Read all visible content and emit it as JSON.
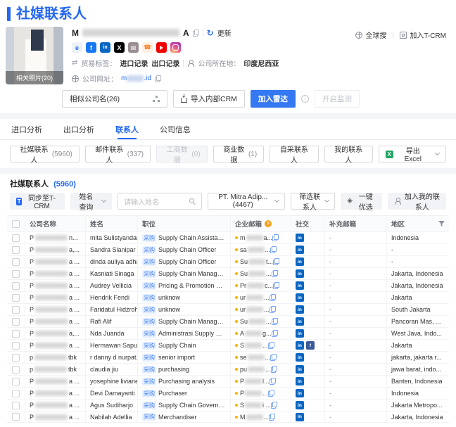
{
  "page": {
    "title": "社媒联系人"
  },
  "colors": {
    "primary": "#2468f2",
    "tag_bg": "#e7f0fe",
    "tag_text": "#4a87f5",
    "email_dot": "#f7b500",
    "linkedin": "#0a66c2",
    "facebook": "#3b5998",
    "excel_green": "#21a463"
  },
  "header": {
    "company_name_prefix": "M",
    "company_name_suffix": "A",
    "update_label": "更新",
    "global_search_label": "全球搜",
    "join_tcrm_label": "加入T-CRM",
    "photo_label": "相关照片(20)",
    "social_icons": [
      "website-icon",
      "facebook-icon",
      "linkedin-icon",
      "x-icon",
      "blog-icon",
      "phone-icon",
      "youtube-icon",
      "instagram-icon"
    ],
    "trade_label": "贸易标签：",
    "import_record": "进口记录",
    "export_record": "出口记录",
    "location_label": "公司所在地：",
    "location_value": "印度尼西亚",
    "website_label": "公司网址：",
    "website_prefix": "m",
    "website_suffix": ".id"
  },
  "actions": {
    "similar_companies_label": "相似公司名(26)",
    "import_crm_label": "导入内部CRM",
    "add_radar_label": "加入雷达",
    "start_monitor_label": "开启监测"
  },
  "tabs": [
    {
      "label": "进口分析",
      "active": false
    },
    {
      "label": "出口分析",
      "active": false
    },
    {
      "label": "联系人",
      "active": true
    },
    {
      "label": "公司信息",
      "active": false
    }
  ],
  "filters": {
    "buttons": [
      {
        "label": "社媒联系人",
        "count": "(5960)",
        "disabled": false
      },
      {
        "label": "邮件联系人",
        "count": "(337)",
        "disabled": false
      },
      {
        "label": "工商数据",
        "count": "(0)",
        "disabled": true
      },
      {
        "label": "商业数据",
        "count": "(1)",
        "disabled": false
      },
      {
        "label": "自采联系人",
        "count": "",
        "disabled": false
      },
      {
        "label": "我的联系人",
        "count": "",
        "disabled": false
      }
    ],
    "export_label": "导出 Excel"
  },
  "section": {
    "title": "社媒联系人",
    "count": "(5960)"
  },
  "toolbar": {
    "sync_label": "同步至T-CRM",
    "name_query_label": "姓名查询",
    "name_placeholder": "请输入姓名",
    "company_filter_value": "PT. Mitra Adip...(4467)",
    "filter_contacts_label": "筛选联系人",
    "quick_select_label": "一键优选",
    "add_my_contacts_label": "加入我的联系人"
  },
  "table": {
    "columns": [
      "公司名称",
      "姓名",
      "职位",
      "企业邮箱",
      "社交",
      "补充邮箱",
      "地区"
    ],
    "tag_label": "采购",
    "rows": [
      {
        "company_prefix": "P",
        "company_suffix": "n...",
        "name": "mita Sulistyandari",
        "position": "Supply Chain Assistant Man...",
        "email_prefix": "m",
        "email_suffix": "a...",
        "socials": [
          "linkedin"
        ],
        "extra_email": "-",
        "region": "Indonesia"
      },
      {
        "company_prefix": "P",
        "company_suffix": "a,...",
        "name": "Sandra Sianipar",
        "position": "Supply Chain Officer",
        "email_prefix": "sa",
        "email_suffix": "...",
        "socials": [
          "linkedin"
        ],
        "extra_email": "-",
        "region": "-"
      },
      {
        "company_prefix": "P",
        "company_suffix": "a ...",
        "name": "dinda auliya adha",
        "position": "Supply Chain Officer",
        "email_prefix": "Su",
        "email_suffix": "t...",
        "socials": [
          "linkedin"
        ],
        "extra_email": "-",
        "region": "-"
      },
      {
        "company_prefix": "P",
        "company_suffix": "a ...",
        "name": "Kasniati Sinaga",
        "position": "Supply Chain Management",
        "email_prefix": "Su",
        "email_suffix": "...",
        "socials": [
          "linkedin"
        ],
        "extra_email": "-",
        "region": "Jakarta, Indonesia"
      },
      {
        "company_prefix": "P",
        "company_suffix": "a ...",
        "name": "Audrey Vellicia",
        "position": "Pricing & Promotion Execut...",
        "email_prefix": "Pr",
        "email_suffix": "c...",
        "socials": [
          "linkedin"
        ],
        "extra_email": "-",
        "region": "Jakarta, Indonesia"
      },
      {
        "company_prefix": "P",
        "company_suffix": "a ...",
        "name": "Hendrik Fendi",
        "position": "unknow",
        "email_prefix": "ur",
        "email_suffix": "...",
        "socials": [
          "linkedin"
        ],
        "extra_email": "-",
        "region": "Jakarta"
      },
      {
        "company_prefix": "P",
        "company_suffix": "a ...",
        "name": "Faridatul Hidzroh",
        "position": "unknow",
        "email_prefix": "ur",
        "email_suffix": "...",
        "socials": [
          "linkedin"
        ],
        "extra_email": "-",
        "region": "South Jakarta"
      },
      {
        "company_prefix": "P",
        "company_suffix": "a ...",
        "name": "Rafi Alif",
        "position": "Supply Chain Management ...",
        "email_prefix": "Su",
        "email_suffix": "...",
        "socials": [
          "linkedin"
        ],
        "extra_email": "-",
        "region": "Pancoran Mas, ..."
      },
      {
        "company_prefix": "P",
        "company_suffix": "a,...",
        "name": "Nda Juanda",
        "position": "Administrasi Supply Chain (...",
        "email_prefix": "A",
        "email_suffix": "g...",
        "socials": [
          "linkedin"
        ],
        "extra_email": "-",
        "region": "West Java, Indo..."
      },
      {
        "company_prefix": "P",
        "company_suffix": "a ...",
        "name": "Hermawan Sapu...",
        "position": "Supply Chain",
        "email_prefix": "S",
        "email_suffix": "...",
        "socials": [
          "linkedin",
          "facebook"
        ],
        "extra_email": "-",
        "region": "Jakarta"
      },
      {
        "company_prefix": "p",
        "company_suffix": "tbk",
        "name": "r danny d nurpat...",
        "position": "senior import",
        "email_prefix": "se",
        "email_suffix": "...",
        "socials": [
          "linkedin"
        ],
        "extra_email": "-",
        "region": "jakarta, jakarta r..."
      },
      {
        "company_prefix": "p",
        "company_suffix": "tbk",
        "name": "claudia jiu",
        "position": "purchasing",
        "email_prefix": "pu",
        "email_suffix": "...",
        "socials": [
          "linkedin"
        ],
        "extra_email": "-",
        "region": "jawa barat, indo..."
      },
      {
        "company_prefix": "P",
        "company_suffix": "a ...",
        "name": "yosephine liviane",
        "position": "Purchasing analysis",
        "email_prefix": "P",
        "email_suffix": "l...",
        "socials": [
          "linkedin"
        ],
        "extra_email": "-",
        "region": "Banten, Indonesia"
      },
      {
        "company_prefix": "P",
        "company_suffix": "a ...",
        "name": "Devi Damayanti",
        "position": "Purchaser",
        "email_prefix": "P",
        "email_suffix": "...",
        "socials": [
          "linkedin"
        ],
        "extra_email": "-",
        "region": "Indonesia"
      },
      {
        "company_prefix": "P",
        "company_suffix": "a ...",
        "name": "Agus Sudiharjo",
        "position": "Supply Chain Governance In...",
        "email_prefix": "S",
        "email_suffix": "i ...",
        "socials": [
          "linkedin"
        ],
        "extra_email": "-",
        "region": "Jakarta Metropo..."
      },
      {
        "company_prefix": "P",
        "company_suffix": "a ...",
        "name": "Nabilah Adellia",
        "position": "Merchandiser",
        "email_prefix": "M",
        "email_suffix": "...",
        "socials": [
          "linkedin"
        ],
        "extra_email": "-",
        "region": "Jakarta, Indonesia"
      }
    ]
  }
}
